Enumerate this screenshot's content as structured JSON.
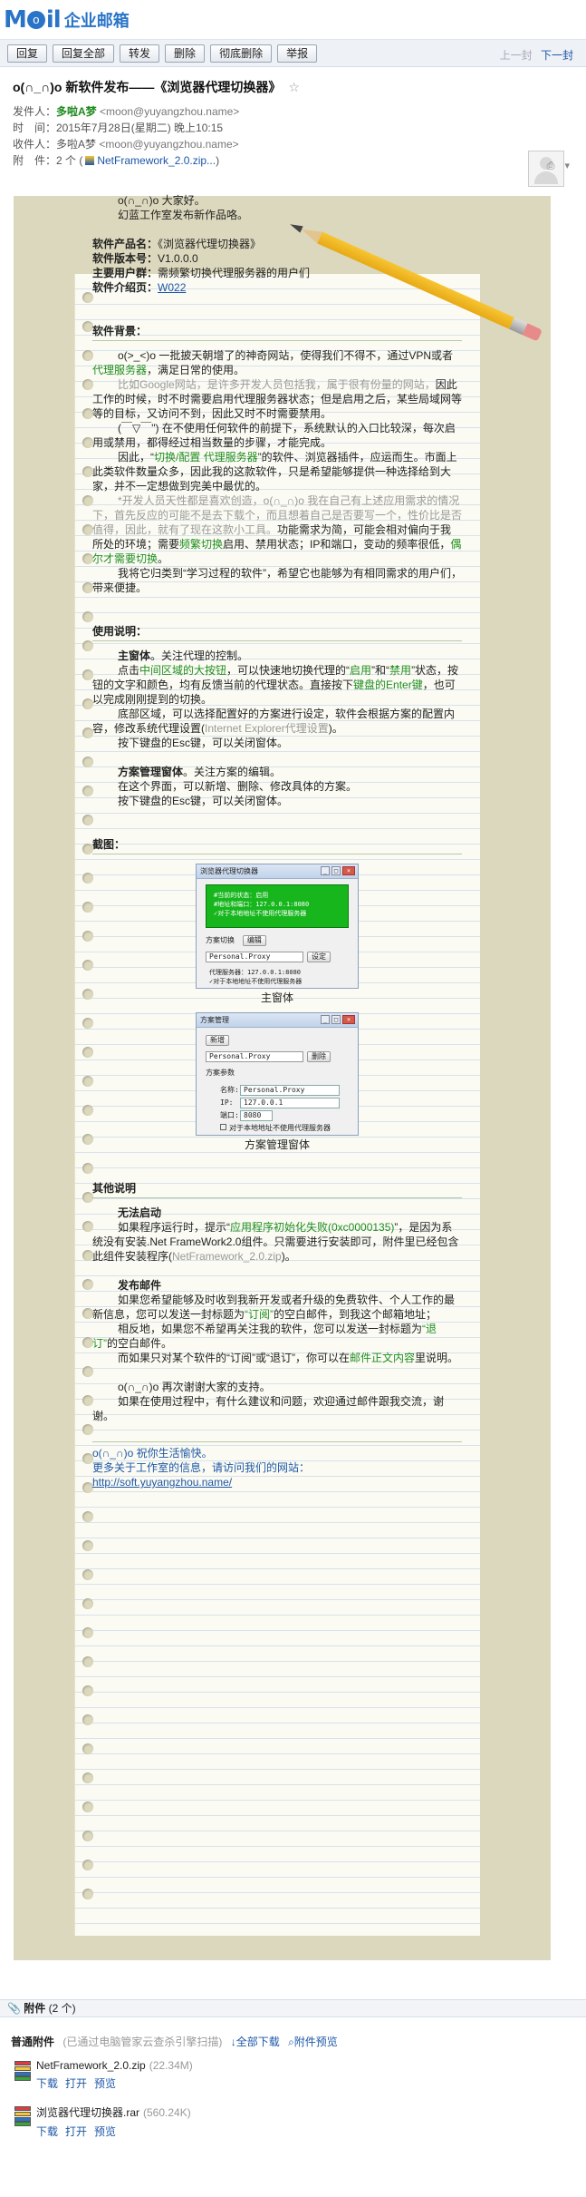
{
  "logo": {
    "text1": "M",
    "o": "o",
    "text2": "il",
    "cn": "企业邮箱"
  },
  "toolbar": {
    "buttons": [
      "回复",
      "回复全部",
      "转发",
      "删除",
      "彻底删除",
      "举报"
    ],
    "prev": "上一封",
    "next": "下一封"
  },
  "header": {
    "subject": "o(∩_∩)o 新软件发布——《浏览器代理切换器》",
    "star": "☆",
    "sender_label": "发件人：",
    "sender_name": "多啦A梦",
    "sender_addr": "<moon@yuyangzhou.name>",
    "time_label": "时　间：",
    "time": "2015年7月28日(星期二) 晚上10:15",
    "to_label": "收件人：",
    "to_name": "多啦A梦",
    "to_addr": "<moon@yuyangzhou.name>",
    "att_label": "附　件：",
    "att_count": "2 个 (",
    "att_file": "NetFramework_2.0.zip...",
    "att_close": ")"
  },
  "body": {
    "greeting1": "o(∩_∩)o 大家好。",
    "greeting2": "幻蓝工作室发布新作品咯。",
    "name_label": "软件产品名：",
    "name_value": "《浏览器代理切换器》",
    "ver_label": "软件版本号：",
    "ver_value": "V1.0.0.0",
    "user_label": "主要用户群：",
    "user_value": "需频繁切换代理服务器的用户们",
    "intro_label": "软件介绍页：",
    "intro_value": "W022",
    "bg_title": "软件背景：",
    "bg_p1a": "o(>_<)o 一批披天朝增了的神奇网站，使得我们不得不，通过VPN或者",
    "bg_p1b": "代理服务器",
    "bg_p1c": "，满足日常的使用。",
    "bg_p2a": "比如Google网站，是许多开发人员包括我，属于很有份量的网站，",
    "bg_p2b": "因此工作的时候，时不时需要启用代理服务器状态；但是启用之后，某些局域网等等的目标，又访问不到，因此又时不时需要禁用。",
    "bg_p3": "(￣▽￣\") 在不使用任何软件的前提下，系统默认的入口比较深，每次启用或禁用，都得经过相当数量的步骤，才能完成。",
    "bg_p4a": "因此，“",
    "bg_p4b": "切换/配置 代理服务器",
    "bg_p4c": "”的软件、浏览器插件，应运而生。市面上此类软件数量众多，因此我的这款软件，只是希望能够提供一种选择给到大家，并不一定想做到完美中最优的。",
    "bg_p5a": "*开发人员天性都是喜欢创造，o(∩_∩)o 我在自己有上述应用需求的情况下，首先反应的可能不是去下载个，而且想着自己是否要写一个，性价比是否值得，因此，就有了现在这款小工具。",
    "bg_p5b": "功能需求为简，可能会相对偏向于我所处的环境；需要",
    "bg_p5c": "频繁切换",
    "bg_p5d": "启用、禁用状态；IP和端口，变动的频率很低，",
    "bg_p5e": "偶尔才需要切换",
    "bg_p5f": "。",
    "bg_p6": "我将它归类到“学习过程的软件”，希望它也能够为有相同需求的用户们，带来便捷。",
    "use_title": "使用说明：",
    "use_p1a": "主窗体",
    "use_p1b": "。关注代理的控制。",
    "use_p2a": "点击",
    "use_p2b": "中间区域的大按钮",
    "use_p2c": "，可以快速地切换代理的“",
    "use_p2d": "启用",
    "use_p2e": "”和“",
    "use_p2f": "禁用",
    "use_p2g": "”状态，按钮的文字和颜色，均有反馈当前的代理状态。直接按下",
    "use_p2h": "键盘的Enter键",
    "use_p2i": "，也可以完成刚刚提到的切换。",
    "use_p3a": "底部区域，可以选择配置好的方案进行设定，软件会根据方案的配置内容，修改系统代理设置(",
    "use_p3b": "Internet Explorer代理设置",
    "use_p3c": ")。",
    "use_p4": "按下键盘的Esc键，可以关闭窗体。",
    "use_p5a": "方案管理窗体",
    "use_p5b": "。关注方案的编辑。",
    "use_p6": "在这个界面，可以新增、删除、修改具体的方案。",
    "use_p7": "按下键盘的Esc键，可以关闭窗体。",
    "shot_title": "截图：",
    "shot1": {
      "title": "浏览器代理切换器",
      "status1": "#当前的状态：启用",
      "status2": "#地址和端口：127.0.0.1:8080",
      "status3": "✓对于本地地址不使用代理服务器",
      "tab_label": "方案切换",
      "edit_btn": "编辑",
      "select": "Personal.Proxy",
      "set_btn": "设定",
      "proxy_line": "代理服务器：127.0.0.1:8080",
      "local_line": "✓对于本地地址不使用代理服务器",
      "caption": "主窗体"
    },
    "shot2": {
      "title": "方案管理",
      "new_btn": "新增",
      "select": "Personal.Proxy",
      "del_btn": "删除",
      "group_label": "方案参数",
      "name_label": "名称:",
      "name_value": "Personal.Proxy",
      "ip_label": "IP:",
      "ip_value": "127.0.0.1",
      "port_label": "端口:",
      "port_value": "8080",
      "check_label": "对于本地地址不使用代理服务器",
      "caption": "方案管理窗体"
    },
    "other_title": "其他说明",
    "o1_title": "无法启动",
    "o1_p1a": "如果程序运行时，提示“",
    "o1_p1b": "应用程序初始化失败(0xc0000135)",
    "o1_p1c": "”，是因为系统没有安装.Net FrameWork2.0组件。只需要进行安装即可，附件里已经包含此组件安装程序(",
    "o1_p1d": "NetFramework_2.0.zip",
    "o1_p1e": ")。",
    "o2_title": "发布邮件",
    "o2_p1": "如果您希望能够及时收到我新开发或者升级的免费软件、个人工作的最新信息，您可以发送一封标题为",
    "o2_p1b": "“订阅”",
    "o2_p1c": "的空白邮件，到我这个邮箱地址；",
    "o2_p2a": "相反地，如果您不希望再关注我的软件，您可以发送一封标题为",
    "o2_p2b": "“退订”",
    "o2_p2c": "的空白邮件。",
    "o2_p3a": "而如果只对某个软件的“订阅”或“退订”，你可以在",
    "o2_p3b": "邮件正文内容",
    "o2_p3c": "里说明。",
    "thanks1": "o(∩_∩)o 再次谢谢大家的支持。",
    "thanks2": "如果在使用过程中，有什么建议和问题，欢迎通过邮件跟我交流，谢谢。",
    "sign1": "o(∩_∩)o  祝你生活愉快。",
    "sign2": "更多关于工作室的信息，请访问我们的网站：",
    "sign3": "http://soft.yuyangzhou.name/"
  },
  "attachments": {
    "bar": "附件",
    "bar_count": "(2 个)",
    "section_label": "普通附件",
    "section_note": "(已通过电脑管家云查杀引擎扫描)",
    "download_all": "全部下载",
    "preview_all": "附件预览",
    "items": [
      {
        "name": "NetFramework_2.0.zip",
        "size": "(22.34M)",
        "download": "下载",
        "open": "打开",
        "preview": "预览"
      },
      {
        "name": "浏览器代理切换器.rar",
        "size": "(560.24K)",
        "download": "下载",
        "open": "打开",
        "preview": "预览"
      }
    ]
  },
  "colors": {
    "accent": "#2a74c8",
    "link": "#1d57a6",
    "green_highlight": "#208e20",
    "paper_bg": "#dcd8bd",
    "status_green": "#17b61d"
  },
  "icons": [
    "avatar-placeholder",
    "star-icon",
    "print-icon",
    "more-icon",
    "paperclip-icon",
    "rar-icon",
    "zip-icon",
    "down-arrow-icon",
    "search-icon"
  ]
}
